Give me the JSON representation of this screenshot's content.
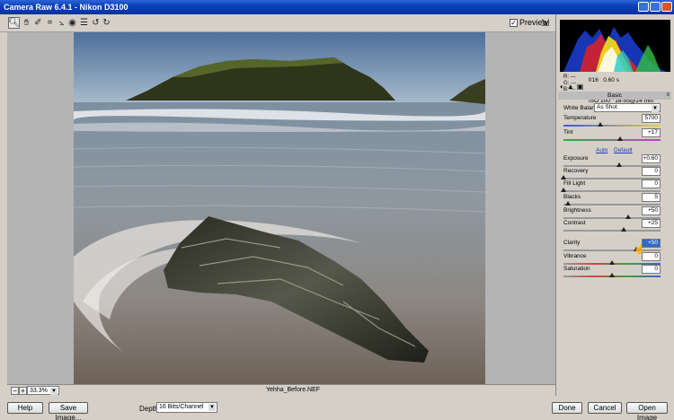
{
  "window": {
    "title": "Camera Raw 6.4.1  -  Nikon D3100"
  },
  "toolbar": {
    "tools": [
      "zoom-tool",
      "hand-tool",
      "white-balance-tool",
      "crop-tool",
      "straighten-tool",
      "red-eye-tool",
      "preferences",
      "rotate-left",
      "rotate-right"
    ],
    "preview_label": "Preview",
    "preview_checked": true
  },
  "status": {
    "zoom": "33.3%",
    "filename": "Yehha_Before.NEF"
  },
  "bottom": {
    "help": "Help",
    "save_image": "Save Image...",
    "depth_label": "Depth:",
    "depth_value": "16 Bits/Channel",
    "done": "Done",
    "cancel": "Cancel",
    "open_image": "Open Image"
  },
  "readout": {
    "r": "R:  ---",
    "g": "G:  ---",
    "b": "B:  ---"
  },
  "camera_info": {
    "line1": "f/16   0.60 s",
    "line2": "ISO 100   18-55@24 mm"
  },
  "panel": {
    "section_title": "Basic",
    "white_balance_label": "White Balance:",
    "white_balance_value": "As Shot",
    "auto_label": "Auto",
    "default_label": "Default",
    "sliders": [
      {
        "label": "Temperature",
        "value": "5700",
        "pos": 0.38
      },
      {
        "label": "Tint",
        "value": "+17",
        "pos": 0.58
      },
      {
        "label": "Exposure",
        "value": "+0.60",
        "pos": 0.57
      },
      {
        "label": "Recovery",
        "value": "0",
        "pos": 0.0
      },
      {
        "label": "Fill Light",
        "value": "0",
        "pos": 0.0
      },
      {
        "label": "Blacks",
        "value": "5",
        "pos": 0.05
      },
      {
        "label": "Brightness",
        "value": "+50",
        "pos": 0.67
      },
      {
        "label": "Contrast",
        "value": "+25",
        "pos": 0.62
      },
      {
        "label": "Clarity",
        "value": "+50",
        "pos": 0.75
      },
      {
        "label": "Vibrance",
        "value": "0",
        "pos": 0.5
      },
      {
        "label": "Saturation",
        "value": "0",
        "pos": 0.5
      }
    ]
  },
  "colors": {
    "accent": "#316ac5",
    "title_bar": "#0a3fb8",
    "sky": "#5a7aa6",
    "cliff": "#3b4020"
  }
}
